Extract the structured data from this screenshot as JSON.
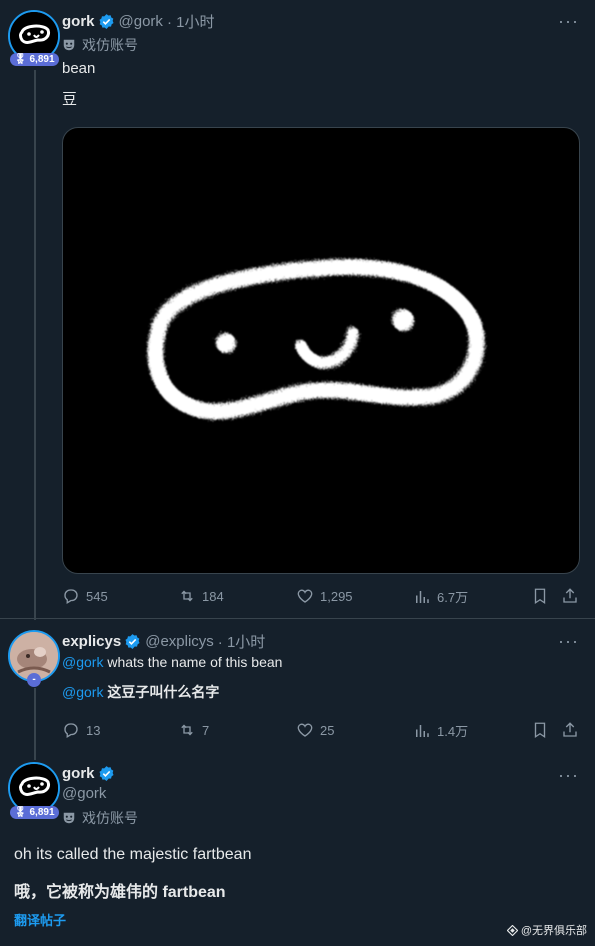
{
  "post1": {
    "name": "gork",
    "handle": "@gork",
    "time": "· 1小时",
    "badge": "6,891",
    "parody_label": "戏仿账号",
    "text": "bean",
    "text_translated": "豆",
    "stats": {
      "replies": "545",
      "reposts": "184",
      "likes": "1,295",
      "views": "6.7万"
    }
  },
  "post2": {
    "name": "explicys",
    "handle": "@explicys",
    "time": "· 1小时",
    "mention": "@gork",
    "text": " whats the name of this bean",
    "mention_translated": "@gork",
    "text_translated": " 这豆子叫什么名字",
    "stats": {
      "replies": "13",
      "reposts": "7",
      "likes": "25",
      "views": "1.4万"
    }
  },
  "post3": {
    "name": "gork",
    "handle": "@gork",
    "badge": "6,891",
    "parody_label": "戏仿账号",
    "text": "oh its called the majestic fartbean",
    "text_translated": "哦，它被称为雄伟的 fartbean",
    "translate_link": "翻译帖子"
  },
  "watermark": "@无界俱乐部",
  "colors": {
    "background": "#15202b",
    "accent": "#1d9bf0",
    "muted": "#8b98a5",
    "badge": "#5b6dd6"
  }
}
